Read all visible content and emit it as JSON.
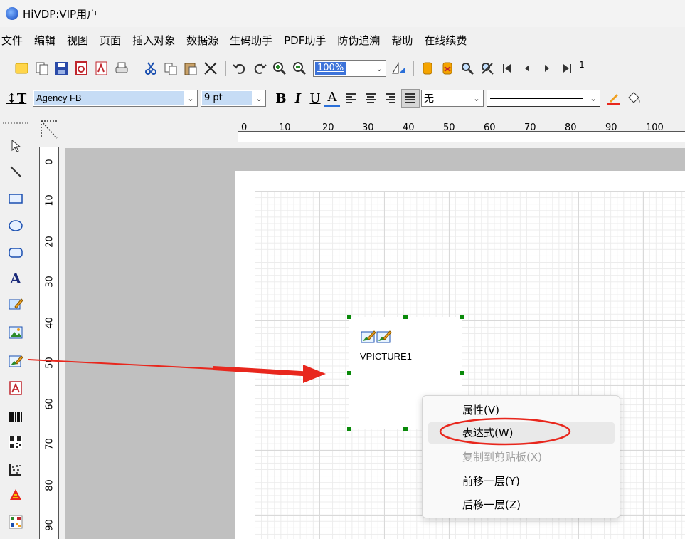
{
  "app": {
    "title": "HiVDP:VIP用户"
  },
  "menu": [
    "文件",
    "编辑",
    "视图",
    "页面",
    "插入对象",
    "数据源",
    "生码助手",
    "PDF助手",
    "防伪追溯",
    "帮助",
    "在线续费"
  ],
  "toolbar": {
    "zoom_value": "100%",
    "page_number": "1"
  },
  "format_bar": {
    "font_name": "Agency FB",
    "font_size": "9 pt",
    "bold": "B",
    "italic": "I",
    "underline": "U",
    "font_color": "A",
    "border_style": "无"
  },
  "ruler": {
    "horizontal": [
      "0",
      "10",
      "20",
      "30",
      "40",
      "50",
      "60",
      "70",
      "80",
      "90",
      "100"
    ],
    "vertical": [
      "0",
      "10",
      "20",
      "30",
      "40",
      "50",
      "60",
      "70",
      "80",
      "90"
    ]
  },
  "element": {
    "name": "VPICTURE1"
  },
  "context_menu": {
    "items": [
      {
        "label": "属性(V)",
        "enabled": true
      },
      {
        "label": "表达式(W)",
        "enabled": true,
        "highlighted": true
      },
      {
        "label": "复制到剪贴板(X)",
        "enabled": false
      },
      {
        "label": "前移一层(Y)",
        "enabled": true
      },
      {
        "label": "后移一层(Z)",
        "enabled": true
      }
    ]
  },
  "colors": {
    "selection_handle": "#0a8a0a",
    "annotation_red": "#e8271d",
    "zoom_highlight": "#3d73d9"
  },
  "icons": {
    "toolbar": [
      "new-icon",
      "open-icon",
      "save-icon",
      "pdf-icon",
      "pdf-export-icon",
      "print-icon",
      "cut-icon",
      "copy-icon",
      "paste-icon",
      "delete-icon",
      "undo-icon",
      "redo-icon",
      "zoom-in-icon",
      "zoom-out-icon",
      "align-icon",
      "database-icon",
      "database-bind-icon",
      "preview-icon",
      "preview-all-icon",
      "first-page-icon",
      "prev-page-icon",
      "next-page-icon",
      "last-page-icon"
    ],
    "palette": [
      "pointer-icon",
      "line-icon",
      "rectangle-icon",
      "ellipse-icon",
      "rounded-rect-icon",
      "text-icon",
      "edit-text-icon",
      "image-icon",
      "variable-image-icon",
      "pdf-object-icon",
      "barcode-icon",
      "qrcode-icon",
      "datamatrix-icon",
      "anti-counterfeit-icon",
      "color-qr-icon"
    ]
  }
}
